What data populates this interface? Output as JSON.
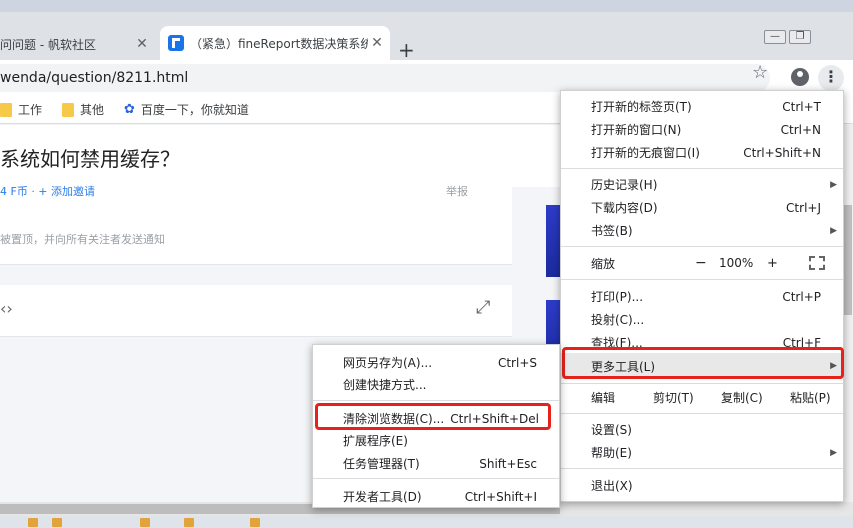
{
  "tabs": [
    {
      "title": "问问题 - 帆软社区",
      "close": "✕"
    },
    {
      "title": "（紧急）fineReport数据决策系统",
      "close": "✕"
    }
  ],
  "newtab_label": "+",
  "window_controls": [
    "—",
    "❐"
  ],
  "url": "wenda/question/8211.html",
  "bookmarks": [
    {
      "label": "工作",
      "icon": "folder-icon"
    },
    {
      "label": "其他",
      "icon": "folder-icon"
    },
    {
      "label": "百度一下，你就知道",
      "icon": "baidu-paw-icon"
    }
  ],
  "page": {
    "question_title": "系统如何禁用缓存？",
    "meta_text": "4 F币 · + 添加邀请",
    "report": "举报",
    "notice": "被置顶，并向所有关注者发送通知"
  },
  "chrome_menu": {
    "items_group1": [
      {
        "label": "打开新的标签页(T)",
        "shortcut": "Ctrl+T"
      },
      {
        "label": "打开新的窗口(N)",
        "shortcut": "Ctrl+N"
      },
      {
        "label": "打开新的无痕窗口(I)",
        "shortcut": "Ctrl+Shift+N"
      }
    ],
    "items_group2": [
      {
        "label": "历史记录(H)",
        "shortcut": "",
        "submenu": true
      },
      {
        "label": "下载内容(D)",
        "shortcut": "Ctrl+J"
      },
      {
        "label": "书签(B)",
        "shortcut": "",
        "submenu": true
      }
    ],
    "zoom": {
      "label": "缩放",
      "minus": "−",
      "value": "100%",
      "plus": "+"
    },
    "items_group3": [
      {
        "label": "打印(P)...",
        "shortcut": "Ctrl+P"
      },
      {
        "label": "投射(C)...",
        "shortcut": ""
      },
      {
        "label": "查找(F)...",
        "shortcut": "Ctrl+F"
      },
      {
        "label": "更多工具(L)",
        "shortcut": "",
        "submenu": true
      }
    ],
    "edit": {
      "label": "编辑",
      "cut": "剪切(T)",
      "copy": "复制(C)",
      "paste": "粘贴(P)"
    },
    "items_group4": [
      {
        "label": "设置(S)",
        "shortcut": ""
      },
      {
        "label": "帮助(E)",
        "shortcut": "",
        "submenu": true
      }
    ],
    "exit": {
      "label": "退出(X)"
    }
  },
  "more_tools_menu": {
    "items_group1": [
      {
        "label": "网页另存为(A)...",
        "shortcut": "Ctrl+S"
      },
      {
        "label": "创建快捷方式...",
        "shortcut": ""
      }
    ],
    "items_group2": [
      {
        "label": "清除浏览数据(C)...",
        "shortcut": "Ctrl+Shift+Del"
      },
      {
        "label": "扩展程序(E)",
        "shortcut": ""
      },
      {
        "label": "任务管理器(T)",
        "shortcut": "Shift+Esc"
      }
    ],
    "items_group3": [
      {
        "label": "开发者工具(D)",
        "shortcut": "Ctrl+Shift+I"
      }
    ]
  },
  "colors": {
    "highlight_red": "#e5221b",
    "link_blue": "#2b7de9"
  }
}
